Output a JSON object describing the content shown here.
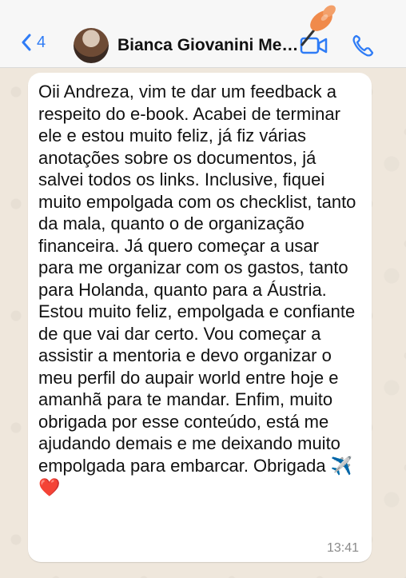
{
  "header": {
    "back_count": "4",
    "contact_name": "Bianca Giovanini Men..."
  },
  "icons": {
    "back": "chevron-left-icon",
    "video": "video-call-icon",
    "phone": "phone-icon",
    "pin": "push-pin-icon"
  },
  "colors": {
    "accent": "#2f7cf6",
    "pin": "#f08a4b",
    "chat_background": "#efe7dc"
  },
  "message": {
    "text": "Oii Andreza, vim te dar um feedback a respeito do e-book. Acabei de terminar ele e estou muito feliz, já fiz várias anotações sobre os documentos, já salvei todos os links. Inclusive, fiquei muito empolgada com os checklist, tanto da mala, quanto o de organização financeira. Já quero começar a usar para me organizar com os gastos, tanto para Holanda, quanto para a Áustria. Estou muito feliz, empolgada e confiante de que vai dar certo. Vou começar a assistir a mentoria e devo organizar o meu perfil do aupair world entre hoje e amanhã para te mandar. Enfim, muito obrigada por esse conteúdo, está me ajudando demais e me deixando muito empolgada para embarcar. Obrigada ✈️❤️",
    "time": "13:41"
  }
}
